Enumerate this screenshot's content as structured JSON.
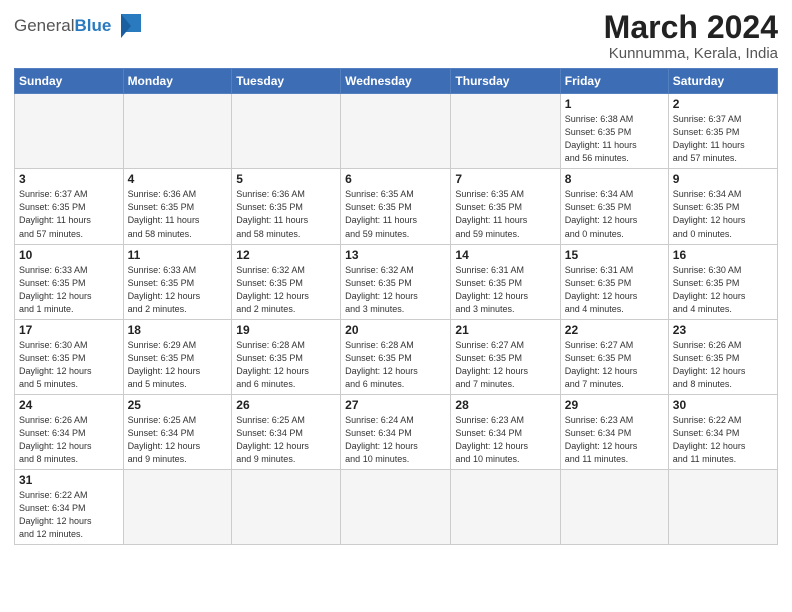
{
  "header": {
    "logo_general": "General",
    "logo_blue": "Blue",
    "title": "March 2024",
    "subtitle": "Kunnumma, Kerala, India"
  },
  "weekdays": [
    "Sunday",
    "Monday",
    "Tuesday",
    "Wednesday",
    "Thursday",
    "Friday",
    "Saturday"
  ],
  "weeks": [
    [
      {
        "day": "",
        "info": ""
      },
      {
        "day": "",
        "info": ""
      },
      {
        "day": "",
        "info": ""
      },
      {
        "day": "",
        "info": ""
      },
      {
        "day": "",
        "info": ""
      },
      {
        "day": "1",
        "info": "Sunrise: 6:38 AM\nSunset: 6:35 PM\nDaylight: 11 hours\nand 56 minutes."
      },
      {
        "day": "2",
        "info": "Sunrise: 6:37 AM\nSunset: 6:35 PM\nDaylight: 11 hours\nand 57 minutes."
      }
    ],
    [
      {
        "day": "3",
        "info": "Sunrise: 6:37 AM\nSunset: 6:35 PM\nDaylight: 11 hours\nand 57 minutes."
      },
      {
        "day": "4",
        "info": "Sunrise: 6:36 AM\nSunset: 6:35 PM\nDaylight: 11 hours\nand 58 minutes."
      },
      {
        "day": "5",
        "info": "Sunrise: 6:36 AM\nSunset: 6:35 PM\nDaylight: 11 hours\nand 58 minutes."
      },
      {
        "day": "6",
        "info": "Sunrise: 6:35 AM\nSunset: 6:35 PM\nDaylight: 11 hours\nand 59 minutes."
      },
      {
        "day": "7",
        "info": "Sunrise: 6:35 AM\nSunset: 6:35 PM\nDaylight: 11 hours\nand 59 minutes."
      },
      {
        "day": "8",
        "info": "Sunrise: 6:34 AM\nSunset: 6:35 PM\nDaylight: 12 hours\nand 0 minutes."
      },
      {
        "day": "9",
        "info": "Sunrise: 6:34 AM\nSunset: 6:35 PM\nDaylight: 12 hours\nand 0 minutes."
      }
    ],
    [
      {
        "day": "10",
        "info": "Sunrise: 6:33 AM\nSunset: 6:35 PM\nDaylight: 12 hours\nand 1 minute."
      },
      {
        "day": "11",
        "info": "Sunrise: 6:33 AM\nSunset: 6:35 PM\nDaylight: 12 hours\nand 2 minutes."
      },
      {
        "day": "12",
        "info": "Sunrise: 6:32 AM\nSunset: 6:35 PM\nDaylight: 12 hours\nand 2 minutes."
      },
      {
        "day": "13",
        "info": "Sunrise: 6:32 AM\nSunset: 6:35 PM\nDaylight: 12 hours\nand 3 minutes."
      },
      {
        "day": "14",
        "info": "Sunrise: 6:31 AM\nSunset: 6:35 PM\nDaylight: 12 hours\nand 3 minutes."
      },
      {
        "day": "15",
        "info": "Sunrise: 6:31 AM\nSunset: 6:35 PM\nDaylight: 12 hours\nand 4 minutes."
      },
      {
        "day": "16",
        "info": "Sunrise: 6:30 AM\nSunset: 6:35 PM\nDaylight: 12 hours\nand 4 minutes."
      }
    ],
    [
      {
        "day": "17",
        "info": "Sunrise: 6:30 AM\nSunset: 6:35 PM\nDaylight: 12 hours\nand 5 minutes."
      },
      {
        "day": "18",
        "info": "Sunrise: 6:29 AM\nSunset: 6:35 PM\nDaylight: 12 hours\nand 5 minutes."
      },
      {
        "day": "19",
        "info": "Sunrise: 6:28 AM\nSunset: 6:35 PM\nDaylight: 12 hours\nand 6 minutes."
      },
      {
        "day": "20",
        "info": "Sunrise: 6:28 AM\nSunset: 6:35 PM\nDaylight: 12 hours\nand 6 minutes."
      },
      {
        "day": "21",
        "info": "Sunrise: 6:27 AM\nSunset: 6:35 PM\nDaylight: 12 hours\nand 7 minutes."
      },
      {
        "day": "22",
        "info": "Sunrise: 6:27 AM\nSunset: 6:35 PM\nDaylight: 12 hours\nand 7 minutes."
      },
      {
        "day": "23",
        "info": "Sunrise: 6:26 AM\nSunset: 6:35 PM\nDaylight: 12 hours\nand 8 minutes."
      }
    ],
    [
      {
        "day": "24",
        "info": "Sunrise: 6:26 AM\nSunset: 6:34 PM\nDaylight: 12 hours\nand 8 minutes."
      },
      {
        "day": "25",
        "info": "Sunrise: 6:25 AM\nSunset: 6:34 PM\nDaylight: 12 hours\nand 9 minutes."
      },
      {
        "day": "26",
        "info": "Sunrise: 6:25 AM\nSunset: 6:34 PM\nDaylight: 12 hours\nand 9 minutes."
      },
      {
        "day": "27",
        "info": "Sunrise: 6:24 AM\nSunset: 6:34 PM\nDaylight: 12 hours\nand 10 minutes."
      },
      {
        "day": "28",
        "info": "Sunrise: 6:23 AM\nSunset: 6:34 PM\nDaylight: 12 hours\nand 10 minutes."
      },
      {
        "day": "29",
        "info": "Sunrise: 6:23 AM\nSunset: 6:34 PM\nDaylight: 12 hours\nand 11 minutes."
      },
      {
        "day": "30",
        "info": "Sunrise: 6:22 AM\nSunset: 6:34 PM\nDaylight: 12 hours\nand 11 minutes."
      }
    ],
    [
      {
        "day": "31",
        "info": "Sunrise: 6:22 AM\nSunset: 6:34 PM\nDaylight: 12 hours\nand 12 minutes."
      },
      {
        "day": "",
        "info": ""
      },
      {
        "day": "",
        "info": ""
      },
      {
        "day": "",
        "info": ""
      },
      {
        "day": "",
        "info": ""
      },
      {
        "day": "",
        "info": ""
      },
      {
        "day": "",
        "info": ""
      }
    ]
  ]
}
